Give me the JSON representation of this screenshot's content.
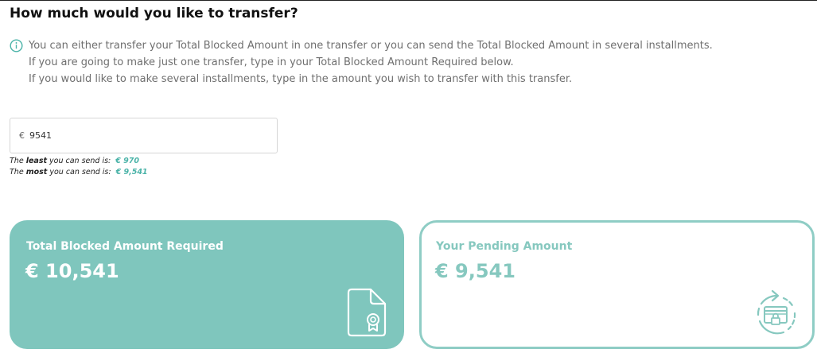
{
  "header": {
    "title": "How much would you like to transfer?"
  },
  "info": {
    "icon": "info-circle-icon",
    "lines": [
      "You can either transfer your Total Blocked Amount in one transfer or you can send the Total Blocked Amount in several installments.",
      "If you are going to make just one transfer, type in your Total Blocked Amount Required below.",
      "If you would like to make several installments, type in the amount you wish to transfer with this transfer."
    ]
  },
  "transfer_input": {
    "currency": "€",
    "value": "9541"
  },
  "limits": {
    "least_prefix": "The ",
    "least_bold": "least",
    "least_suffix": " you can send is:",
    "least_value": "€ 970",
    "most_prefix": "The ",
    "most_bold": "most",
    "most_suffix": " you can send is:",
    "most_value": "€ 9,541"
  },
  "cards": {
    "total": {
      "label": "Total Blocked Amount Required",
      "amount": "€ 10,541",
      "icon": "certificate-document-icon"
    },
    "pending": {
      "label": "Your Pending Amount",
      "amount": "€ 9,541",
      "icon": "locked-wallet-refresh-icon"
    }
  },
  "colors": {
    "accent": "#7fc6bd",
    "accent_text": "#4ab3a8",
    "pending_border": "#8fcdc5"
  }
}
